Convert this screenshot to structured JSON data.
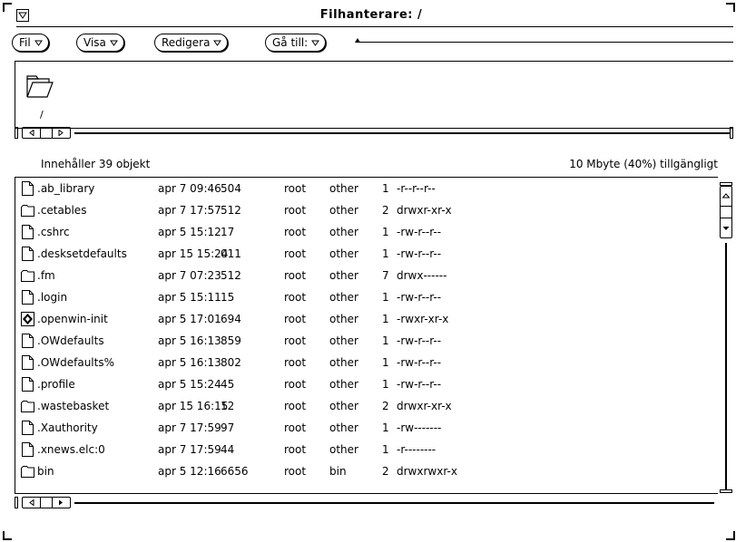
{
  "window": {
    "title": "Filhanterare: /"
  },
  "menus": [
    {
      "label": "Fil"
    },
    {
      "label": "Visa"
    },
    {
      "label": "Redigera"
    },
    {
      "label": "Gå till:"
    }
  ],
  "path": {
    "current": "/"
  },
  "status": {
    "count": "Innehåller 39 objekt",
    "space": "10 Mbyte (40%) tillgängligt"
  },
  "files": [
    {
      "icon": "file-icon",
      "name": ".ab_library",
      "date": "apr  7 09:46",
      "size": "504",
      "owner": "root",
      "group": "other",
      "links": "1",
      "perms": "-r--r--r--"
    },
    {
      "icon": "folder-icon",
      "name": ".cetables",
      "date": "apr  7 17:57",
      "size": "512",
      "owner": "root",
      "group": "other",
      "links": "2",
      "perms": "drwxr-xr-x"
    },
    {
      "icon": "file-icon",
      "name": ".cshrc",
      "date": "apr  5 15:12",
      "size": "17",
      "owner": "root",
      "group": "other",
      "links": "1",
      "perms": "-rw-r--r--"
    },
    {
      "icon": "file-icon",
      "name": ".desksetdefaults",
      "date": "apr 15 15:24",
      "size": "011",
      "owner": "root",
      "group": "other",
      "links": "1",
      "perms": "-rw-r--r--"
    },
    {
      "icon": "folder-icon",
      "name": ".fm",
      "date": "apr  7 07:23",
      "size": "512",
      "owner": "root",
      "group": "other",
      "links": "7",
      "perms": "drwx------"
    },
    {
      "icon": "file-icon",
      "name": ".login",
      "date": "apr  5 15:11",
      "size": "15",
      "owner": "root",
      "group": "other",
      "links": "1",
      "perms": "-rw-r--r--"
    },
    {
      "icon": "exec-icon",
      "name": ".openwin-init",
      "date": "apr  5 17:01",
      "size": "694",
      "owner": "root",
      "group": "other",
      "links": "1",
      "perms": "-rwxr-xr-x"
    },
    {
      "icon": "file-icon",
      "name": ".OWdefaults",
      "date": "apr  5 16:13",
      "size": "859",
      "owner": "root",
      "group": "other",
      "links": "1",
      "perms": "-rw-r--r--"
    },
    {
      "icon": "file-icon",
      "name": ".OWdefaults%",
      "date": "apr  5 16:13",
      "size": "802",
      "owner": "root",
      "group": "other",
      "links": "1",
      "perms": "-rw-r--r--"
    },
    {
      "icon": "file-icon",
      "name": ".profile",
      "date": "apr  5 15:24",
      "size": "45",
      "owner": "root",
      "group": "other",
      "links": "1",
      "perms": "-rw-r--r--"
    },
    {
      "icon": "folder-icon",
      "name": ".wastebasket",
      "date": "apr 15 16:15",
      "size": "12",
      "owner": "root",
      "group": "other",
      "links": "2",
      "perms": "drwxr-xr-x"
    },
    {
      "icon": "file-icon",
      "name": ".Xauthority",
      "date": "apr  7 17:59",
      "size": "97",
      "owner": "root",
      "group": "other",
      "links": "1",
      "perms": "-rw-------"
    },
    {
      "icon": "file-icon",
      "name": ".xnews.elc:0",
      "date": "apr  7 17:59",
      "size": "44",
      "owner": "root",
      "group": "other",
      "links": "1",
      "perms": "-r--------"
    },
    {
      "icon": "folder-icon",
      "name": "bin",
      "date": "apr  5 12:16",
      "size": "6656",
      "owner": "root",
      "group": "bin",
      "links": "2",
      "perms": "drwxrwxr-x"
    }
  ]
}
